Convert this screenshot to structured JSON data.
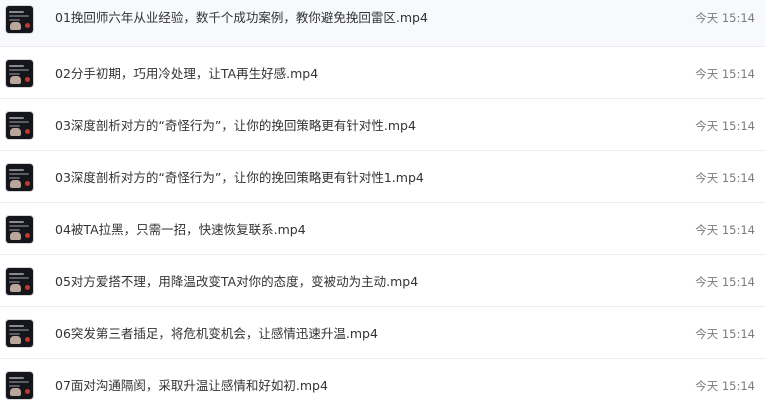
{
  "files": [
    {
      "name": "01挽回师六年从业经验，数千个成功案例，教你避免挽回雷区.mp4",
      "time": "今天 15:14",
      "thumb_icon": "video-thumbnail-icon"
    },
    {
      "name": "02分手初期，巧用冷处理，让TA再生好感.mp4",
      "time": "今天 15:14",
      "thumb_icon": "video-thumbnail-icon"
    },
    {
      "name": "03深度剖析对方的“奇怪行为”，让你的挽回策略更有针对性.mp4",
      "time": "今天 15:14",
      "thumb_icon": "video-thumbnail-icon"
    },
    {
      "name": "03深度剖析对方的“奇怪行为”，让你的挽回策略更有针对性1.mp4",
      "time": "今天 15:14",
      "thumb_icon": "video-thumbnail-icon"
    },
    {
      "name": "04被TA拉黑，只需一招，快速恢复联系.mp4",
      "time": "今天 15:14",
      "thumb_icon": "video-thumbnail-icon"
    },
    {
      "name": "05对方爱搭不理，用降温改变TA对你的态度，变被动为主动.mp4",
      "time": "今天 15:14",
      "thumb_icon": "video-thumbnail-icon"
    },
    {
      "name": "06突发第三者插足，将危机变机会，让感情迅速升温.mp4",
      "time": "今天 15:14",
      "thumb_icon": "video-thumbnail-icon"
    },
    {
      "name": "07面对沟通隔阂，采取升温让感情和好如初.mp4",
      "time": "今天 15:14",
      "thumb_icon": "video-thumbnail-icon"
    }
  ]
}
